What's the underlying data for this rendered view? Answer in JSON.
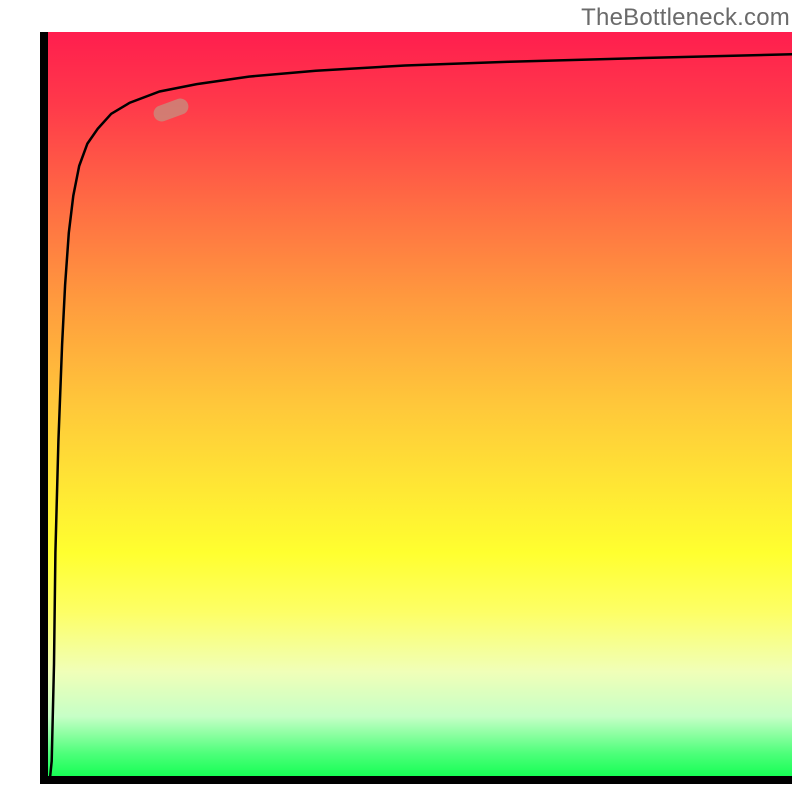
{
  "watermark": "TheBottleneck.com",
  "chart_data": {
    "type": "line",
    "title": "",
    "xlabel": "",
    "ylabel": "",
    "xlim": [
      0,
      100
    ],
    "ylim": [
      0,
      100
    ],
    "grid": false,
    "legend": false,
    "background_gradient": {
      "top": "#ff1e4e",
      "mid_upper": "#ff9a3e",
      "mid": "#ffff2f",
      "mid_lower": "#f0ffb8",
      "bottom": "#17ff55"
    },
    "series": [
      {
        "name": "curve",
        "x": [
          0.3,
          0.5,
          0.8,
          1.0,
          1.4,
          1.9,
          2.3,
          2.8,
          3.4,
          4.2,
          5.3,
          6.7,
          8.5,
          11,
          15,
          20,
          27,
          36,
          48,
          62,
          80,
          100
        ],
        "y": [
          0,
          2,
          15,
          30,
          45,
          58,
          66,
          73,
          78,
          82,
          85,
          87,
          89,
          90.5,
          92,
          93,
          94,
          94.8,
          95.5,
          96,
          96.5,
          97
        ]
      }
    ],
    "marker": {
      "x": 16.5,
      "y": 89.5,
      "color": "#c68d7d"
    }
  }
}
